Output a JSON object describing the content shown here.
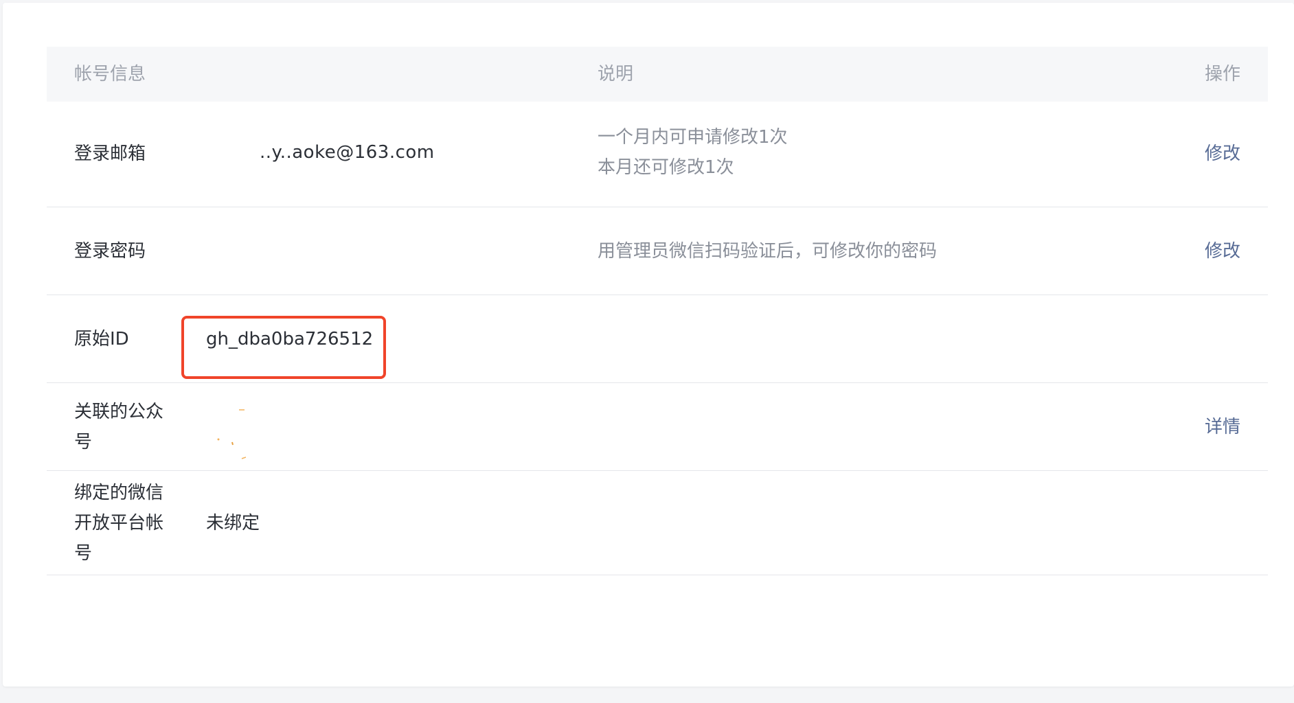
{
  "header": {
    "col_account": "帐号信息",
    "col_desc": "说明",
    "col_action": "操作"
  },
  "rows": {
    "email": {
      "label": "登录邮箱",
      "value": "..y..aoke@163.com",
      "desc_line1": "一个月内可申请修改1次",
      "desc_line2": "本月还可修改1次",
      "action": "修改"
    },
    "password": {
      "label": "登录密码",
      "desc": "用管理员微信扫码验证后，可修改你的密码",
      "action": "修改"
    },
    "original_id": {
      "label": "原始ID",
      "value": "gh_dba0ba726512"
    },
    "linked_account": {
      "label_line1": "关联的公众",
      "label_line2": "号",
      "action": "详情"
    },
    "open_platform": {
      "label_line1": "绑定的微信",
      "label_line2": "开放平台帐",
      "label_line3": "号",
      "value": "未绑定"
    }
  },
  "colors": {
    "link": "#576b95",
    "highlight": "#f0442a"
  }
}
